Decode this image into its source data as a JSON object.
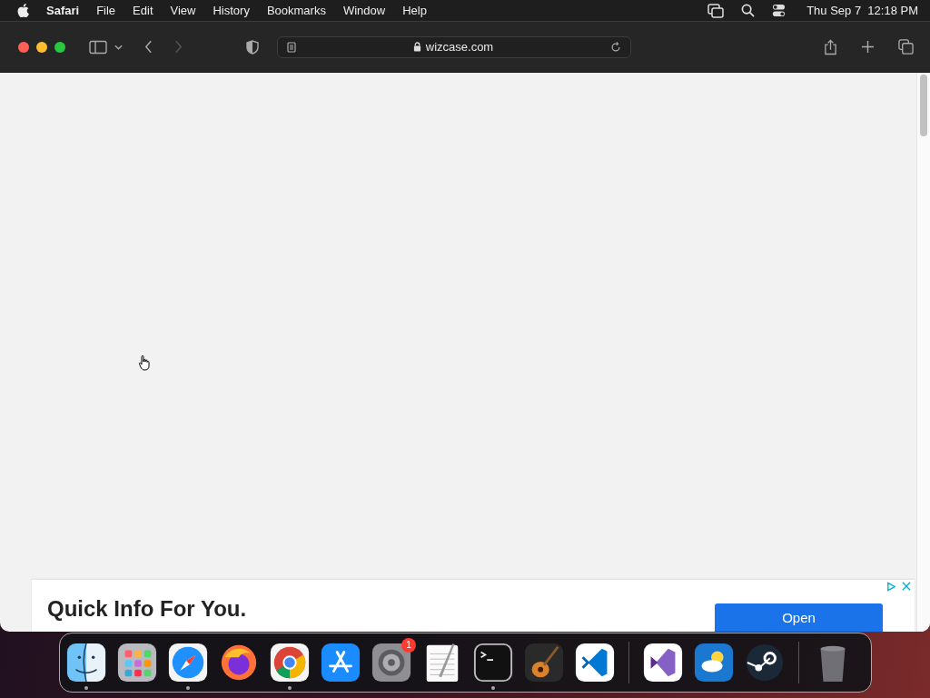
{
  "menu_bar": {
    "app_name": "Safari",
    "menus": [
      "File",
      "Edit",
      "View",
      "History",
      "Bookmarks",
      "Window",
      "Help"
    ],
    "clock": "Thu Sep 7  12:18 PM"
  },
  "toolbar": {
    "address": "wizcase.com",
    "forward_disabled": true
  },
  "ad": {
    "headline": "Quick Info For You.",
    "button": "Open"
  },
  "dock": {
    "apps": [
      {
        "kind": "finder",
        "running": true
      },
      {
        "kind": "launchpad",
        "running": false
      },
      {
        "kind": "safari",
        "running": true
      },
      {
        "kind": "firefox",
        "running": false
      },
      {
        "kind": "chrome",
        "running": true
      },
      {
        "kind": "appstore",
        "running": false
      },
      {
        "kind": "settings",
        "running": false,
        "badge": "1"
      },
      {
        "kind": "textedit",
        "running": false
      },
      {
        "kind": "terminal",
        "running": true
      },
      {
        "kind": "garageband",
        "running": false
      },
      {
        "kind": "vscode",
        "running": false
      },
      {
        "kind": "separator"
      },
      {
        "kind": "visualstudio",
        "running": false
      },
      {
        "kind": "weather",
        "running": false
      },
      {
        "kind": "steam",
        "running": false
      },
      {
        "kind": "separator"
      },
      {
        "kind": "trash",
        "running": false
      }
    ]
  }
}
